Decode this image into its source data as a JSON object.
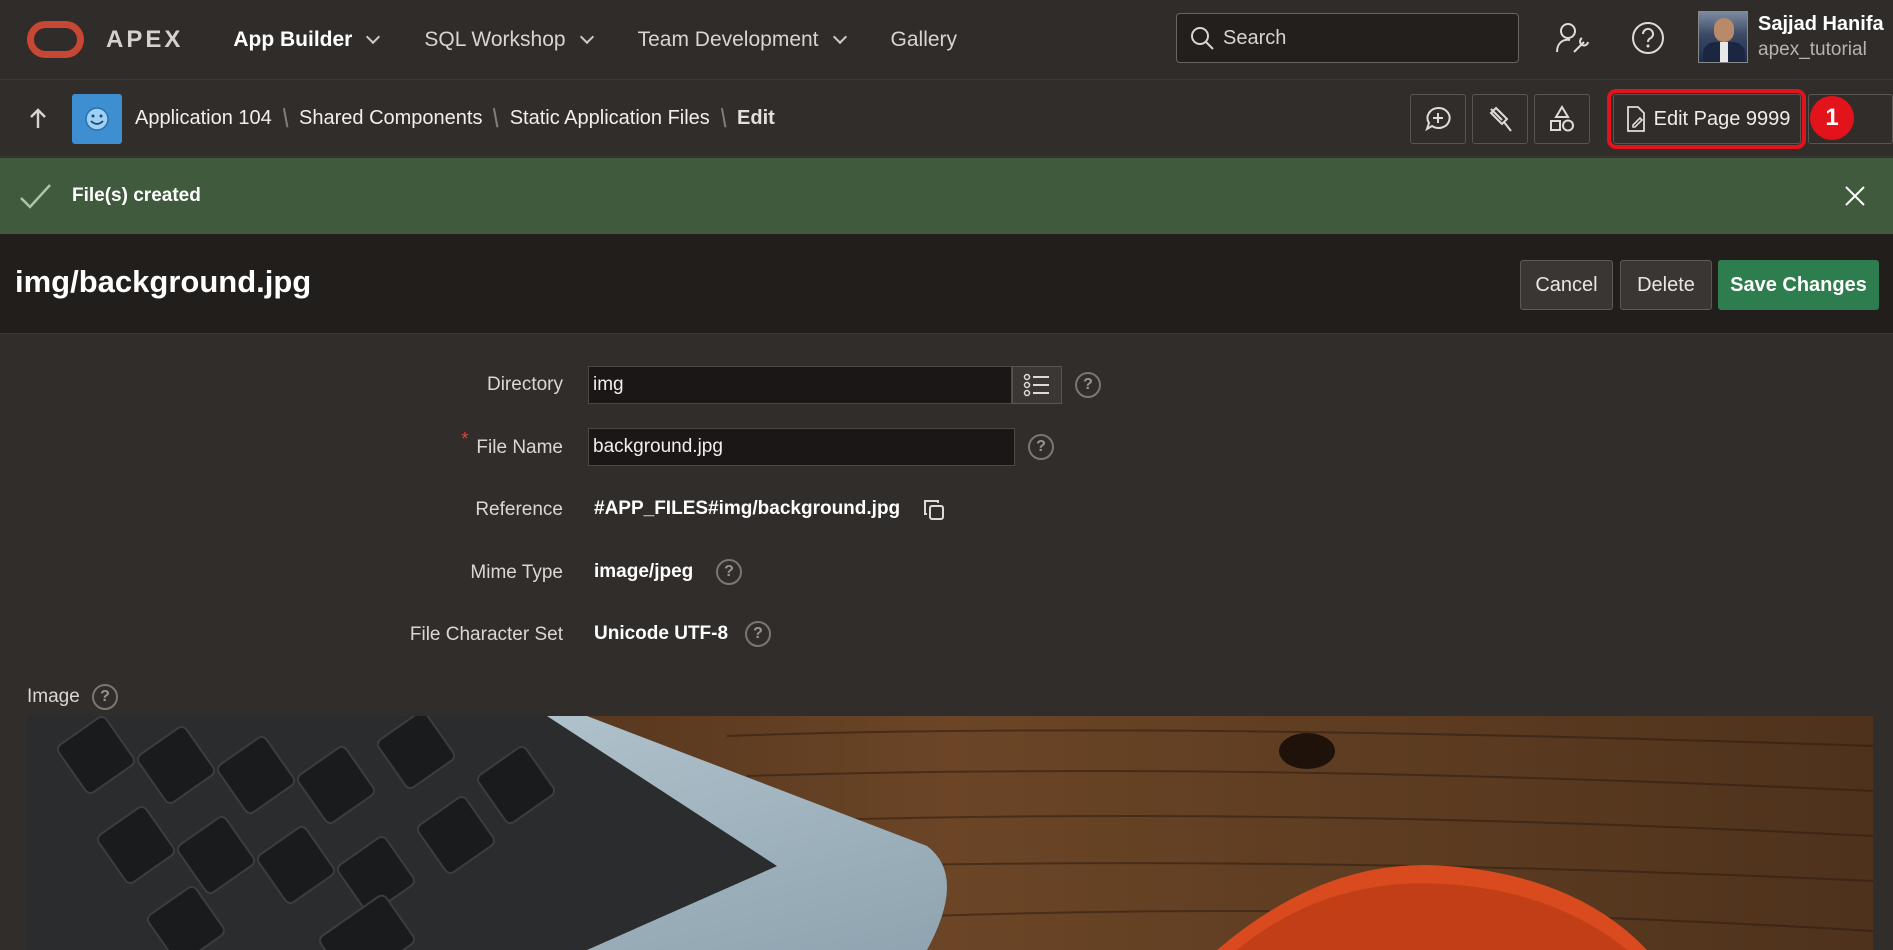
{
  "topnav": {
    "logo_text": "APEX",
    "menu": [
      {
        "label": "App Builder",
        "active": true,
        "has_dropdown": true
      },
      {
        "label": "SQL Workshop",
        "active": false,
        "has_dropdown": true
      },
      {
        "label": "Team Development",
        "active": false,
        "has_dropdown": true
      },
      {
        "label": "Gallery",
        "active": false,
        "has_dropdown": false
      }
    ],
    "search_placeholder": "Search",
    "user": {
      "name": "Sajjad Hanifa",
      "workspace": "apex_tutorial"
    },
    "icons": [
      "search-icon",
      "admin-services-icon",
      "help-icon",
      "user-avatar"
    ]
  },
  "breadcrumb": {
    "items": [
      "Application 104",
      "Shared Components",
      "Static Application Files"
    ],
    "current": "Edit",
    "edit_page_label": "Edit Page 9999",
    "annotation_badge": "1",
    "icons": [
      "up-arrow-icon",
      "app-icon",
      "comment-add-icon",
      "pin-icon",
      "shapes-icon",
      "page-edit-icon"
    ]
  },
  "success": {
    "message": "File(s) created"
  },
  "page": {
    "title": "img/background.jpg",
    "buttons": {
      "cancel": "Cancel",
      "delete": "Delete",
      "save": "Save Changes"
    }
  },
  "form": {
    "directory": {
      "label": "Directory",
      "value": "img"
    },
    "file_name": {
      "label": "File Name",
      "value": "background.jpg",
      "required": true
    },
    "reference": {
      "label": "Reference",
      "value": "#APP_FILES#img/background.jpg"
    },
    "mime_type": {
      "label": "Mime Type",
      "value": "image/jpeg"
    },
    "charset": {
      "label": "File Character Set",
      "value": "Unicode UTF-8"
    },
    "image_label": "Image"
  },
  "colors": {
    "brand_red": "#c74634",
    "success_bg": "#3f5a3d",
    "save_green": "#2e7d4e",
    "annotation_red": "#e2131a"
  }
}
